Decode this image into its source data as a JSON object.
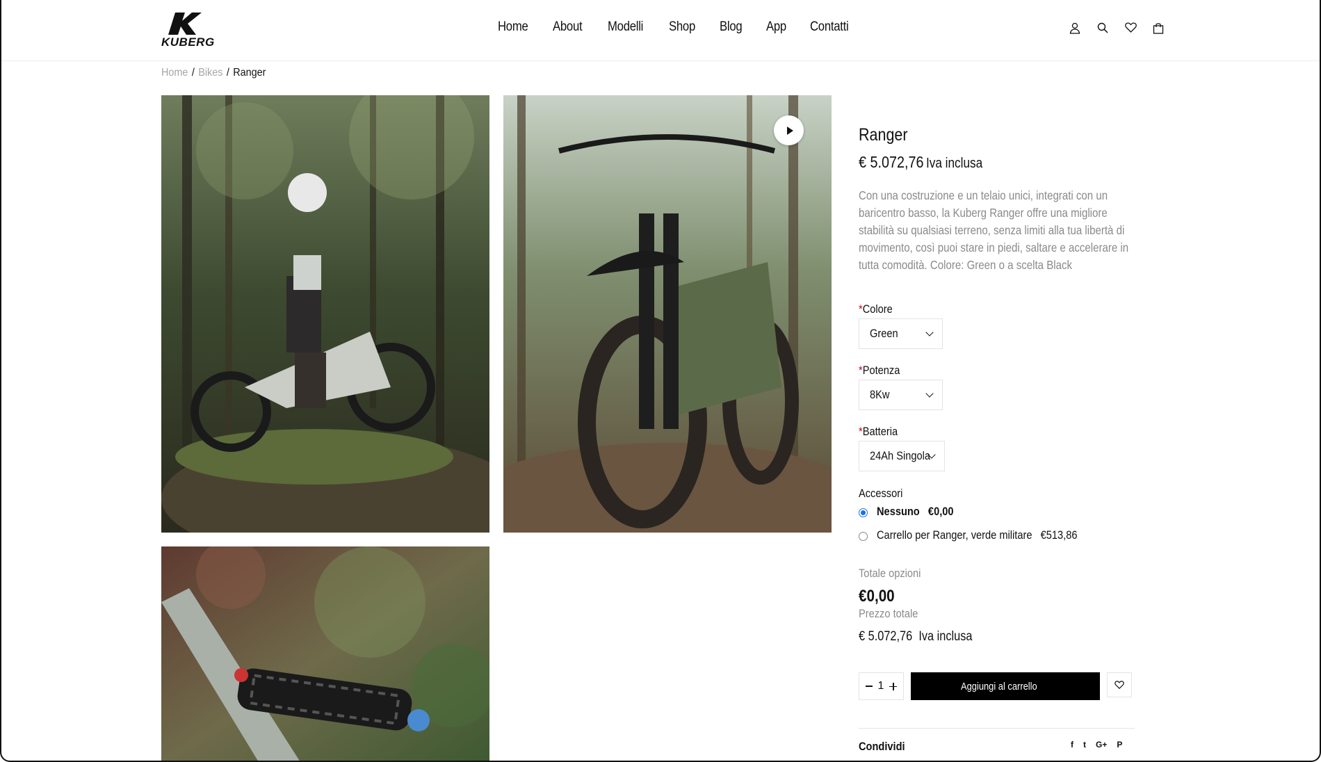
{
  "brand": {
    "logo_text": "KUBERG"
  },
  "nav": {
    "items": [
      "Home",
      "About",
      "Modelli",
      "Shop",
      "Blog",
      "App",
      "Contatti"
    ]
  },
  "header_icons": [
    "user-icon",
    "search-icon",
    "heart-icon",
    "bag-icon"
  ],
  "breadcrumb": {
    "home": "Home",
    "category": "Bikes",
    "current": "Ranger",
    "separator": "/"
  },
  "gallery": {
    "images": [
      "rider-on-rock-photo",
      "bike-front-photo",
      "suspension-closeup-photo"
    ],
    "video_button": "play-icon"
  },
  "product": {
    "title": "Ranger",
    "price": "€ 5.072,76",
    "vat_label": "Iva inclusa",
    "description_lines": [
      "Con una costruzione e un telaio unici, integrati con un",
      "baricentro basso, la Kuberg Ranger offre una migliore",
      "stabilità su qualsiasi terreno, senza limiti alla tua libertà di",
      "movimento, così puoi stare in piedi, saltare e accelerare in",
      "tutta comodità. Colore: Green o a scelta Black"
    ]
  },
  "options": {
    "required_mark": "*",
    "colore": {
      "label": "Colore",
      "value": "Green"
    },
    "potenza": {
      "label": "Potenza",
      "value": "8Kw"
    },
    "batteria": {
      "label": "Batteria",
      "value": "24Ah Singola"
    }
  },
  "accessories": {
    "label": "Accessori",
    "items": [
      {
        "name": "Nessuno",
        "price": "€0,00",
        "selected": true
      },
      {
        "name": "Carrello per Ranger, verde militare",
        "price": "€513,86",
        "selected": false
      }
    ]
  },
  "totals": {
    "options_label": "Totale opzioni",
    "options_value": "€0,00",
    "total_label": "Prezzo totale",
    "total_value": "€ 5.072,76",
    "vat_label": "Iva inclusa"
  },
  "cart": {
    "quantity": "1",
    "add_label": "Aggiungi al carrello"
  },
  "share": {
    "label": "Condividi",
    "networks": [
      "f",
      "t",
      "G+",
      "P"
    ]
  },
  "colors": {
    "accent": "#000000",
    "required": "#d0021b",
    "radio": "#1a73e8",
    "muted": "#8a8a8a"
  }
}
